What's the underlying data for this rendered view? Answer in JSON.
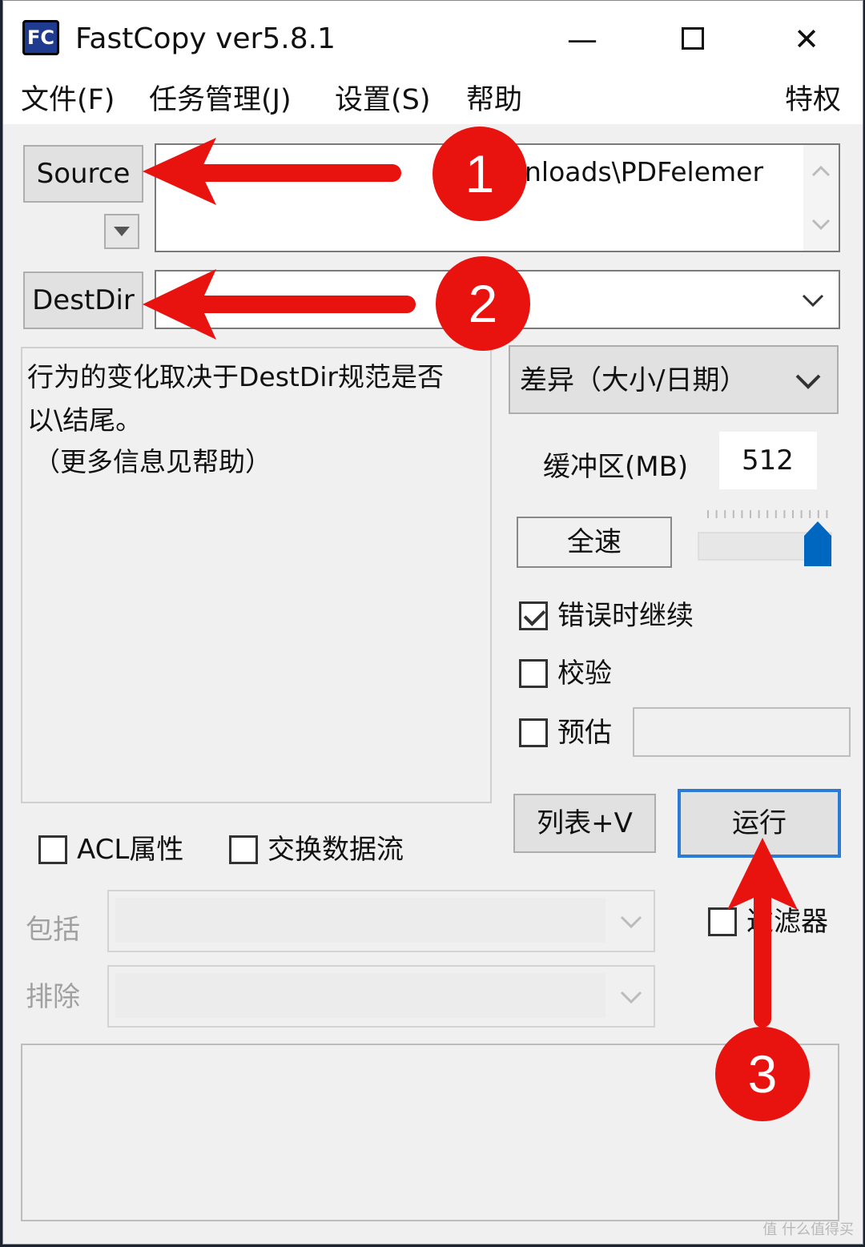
{
  "window": {
    "title": "FastCopy ver5.8.1",
    "app_icon_text": "FC"
  },
  "titlebar_controls": {
    "minimize": "—",
    "maximize": "☐",
    "close": "✕"
  },
  "menu": [
    "文件(F)",
    "任务管理(J)",
    "设置(S)",
    "帮助",
    "特权"
  ],
  "source": {
    "button_label": "Source",
    "path_visible_fragment": "nloads\\PDFelemer"
  },
  "destdir": {
    "button_label": "DestDir"
  },
  "info_text": {
    "line1": "行为的变化取决于DestDir规范是否",
    "line2": "以\\结尾。",
    "line3": "（更多信息见帮助）"
  },
  "mode_select": {
    "selected": "差异（大小/日期）"
  },
  "buffer": {
    "label": "缓冲区(MB)",
    "value": "512"
  },
  "speed": {
    "button_label": "全速",
    "slider_level": 1.0
  },
  "options": {
    "continue_on_error": {
      "label": "错误时继续",
      "checked": true
    },
    "verify": {
      "label": "校验",
      "checked": false
    },
    "estimate": {
      "label": "预估",
      "checked": false
    }
  },
  "buttons": {
    "listv": "列表+V",
    "run": "运行"
  },
  "bottom_options": {
    "acl": {
      "label": "ACL属性",
      "checked": false
    },
    "alt_stream": {
      "label": "交换数据流",
      "checked": false
    },
    "filter": {
      "label": "过滤器",
      "checked": false
    }
  },
  "filters": {
    "include_label": "包括",
    "exclude_label": "排除"
  },
  "annotations": {
    "badge1": "1",
    "badge2": "2",
    "badge3": "3",
    "color": "#e8120f"
  },
  "watermark": "值 什么值得买"
}
